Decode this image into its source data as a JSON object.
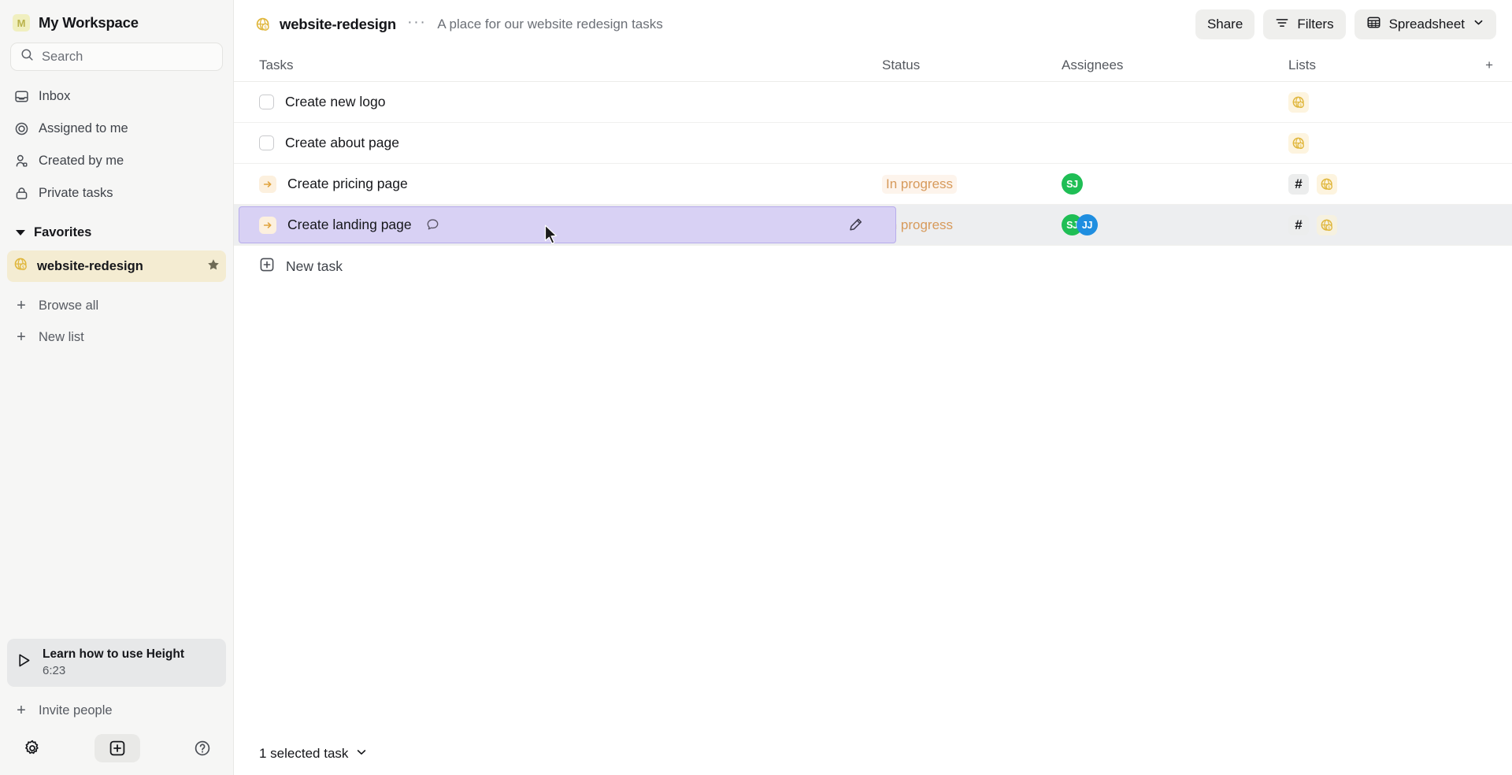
{
  "workspace": {
    "avatar_letter": "M",
    "name": "My Workspace"
  },
  "search": {
    "placeholder": "Search"
  },
  "sidebar": {
    "nav": [
      {
        "label": "Inbox",
        "icon": "inbox-icon"
      },
      {
        "label": "Assigned to me",
        "icon": "target-icon"
      },
      {
        "label": "Created by me",
        "icon": "user-icon"
      },
      {
        "label": "Private tasks",
        "icon": "lock-icon"
      }
    ],
    "favorites_label": "Favorites",
    "favorite_item": {
      "label": "website-redesign",
      "icon": "globe-money-icon",
      "star": "star-icon"
    },
    "actions": [
      {
        "label": "Browse all"
      },
      {
        "label": "New list"
      }
    ],
    "learn_card": {
      "title": "Learn how to use Height",
      "duration": "6:23"
    },
    "invite_label": "Invite people",
    "bottom_icons": [
      "gear-icon",
      "add-box-icon",
      "help-icon"
    ]
  },
  "topbar": {
    "list_icon": "globe-money-icon",
    "title": "website-redesign",
    "more": "···",
    "description": "A place for our website redesign tasks",
    "share_label": "Share",
    "filters_label": "Filters",
    "view_label": "Spreadsheet"
  },
  "table": {
    "columns": {
      "tasks": "Tasks",
      "status": "Status",
      "assignees": "Assignees",
      "lists": "Lists",
      "add": "+"
    },
    "rows": [
      {
        "name": "Create new logo",
        "marker": "checkbox",
        "status": "",
        "assignees": [],
        "lists": [
          "globe"
        ],
        "selected": false,
        "has_comment": false
      },
      {
        "name": "Create about page",
        "marker": "checkbox",
        "status": "",
        "assignees": [],
        "lists": [
          "globe"
        ],
        "selected": false,
        "has_comment": false
      },
      {
        "name": "Create pricing page",
        "marker": "arrow",
        "status": "In progress",
        "assignees": [
          {
            "initials": "SJ",
            "color": "#1fbe55"
          }
        ],
        "lists": [
          "hash",
          "globe"
        ],
        "selected": false,
        "has_comment": false
      },
      {
        "name": "Create landing page",
        "marker": "arrow",
        "status": "In progress",
        "assignees": [
          {
            "initials": "SJ",
            "color": "#1fbe55"
          },
          {
            "initials": "JJ",
            "color": "#1f8ee0"
          }
        ],
        "lists": [
          "hash",
          "globe"
        ],
        "selected": true,
        "has_comment": true
      }
    ],
    "new_task_label": "New task"
  },
  "statusbar": {
    "selection_label": "1 selected task"
  },
  "colors": {
    "selection_purple": "#d8d1f4",
    "selection_border": "#b7aceb",
    "favorite_bg": "#f4ecd2",
    "status_orange": "#d79a5b",
    "accent_yellow": "#e0b73d"
  }
}
